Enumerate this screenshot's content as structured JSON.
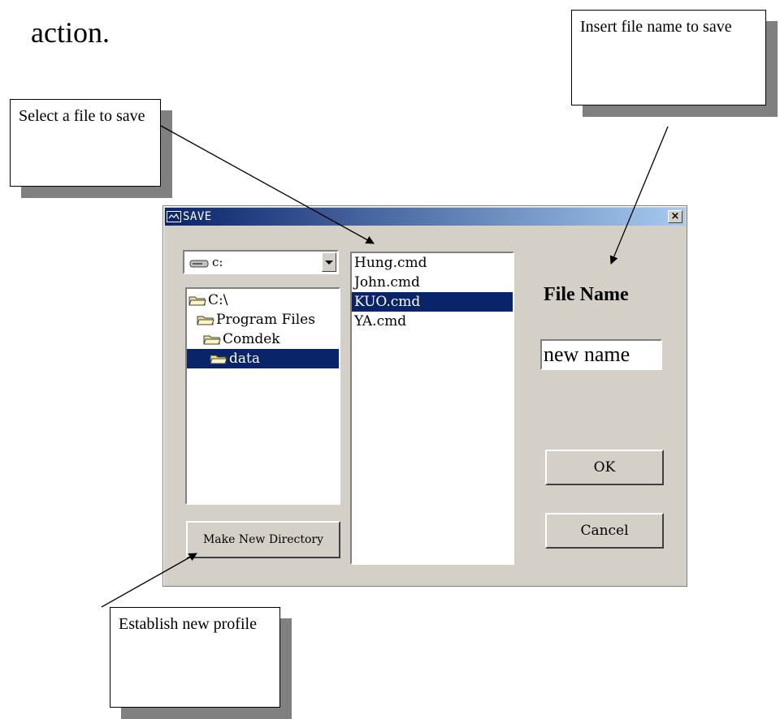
{
  "page": {
    "text": "action."
  },
  "callouts": {
    "insert": "Insert file name to save",
    "select": "Select a file to save",
    "establish": "Establish new profile"
  },
  "dialog": {
    "title": "SAVE",
    "close_label": "×",
    "drive": {
      "value": "c:"
    },
    "folders": [
      {
        "label": "C:\\",
        "icon": "open-folder-icon"
      },
      {
        "label": "Program Files",
        "icon": "open-folder-icon"
      },
      {
        "label": "Comdek",
        "icon": "open-folder-icon"
      },
      {
        "label": "data",
        "icon": "open-folder-icon",
        "selected": true
      }
    ],
    "files": [
      {
        "label": "Hung.cmd"
      },
      {
        "label": "John.cmd"
      },
      {
        "label": "KUO.cmd",
        "selected": true
      },
      {
        "label": "YA.cmd"
      }
    ],
    "file_name_label": "File Name",
    "file_name_value": "new name",
    "ok_label": "OK",
    "cancel_label": "Cancel",
    "mkdir_label": "Make New Directory",
    "colors": {
      "titlebar": "#0a246a",
      "selection": "#0a246a",
      "face": "#d4d0c8"
    }
  }
}
